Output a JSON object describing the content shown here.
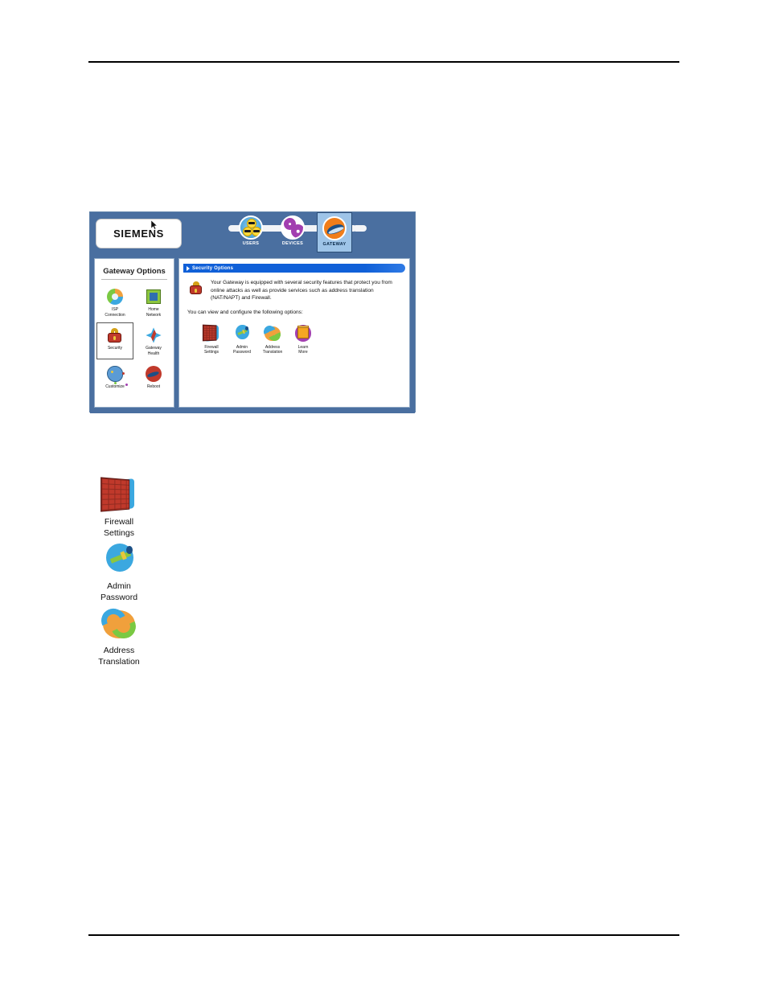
{
  "document": {
    "has_top_rule": true,
    "has_bottom_rule": true
  },
  "ui": {
    "brand": "SIEMENS",
    "cursor_icon": "mouse-pointer-icon",
    "nav_tabs": [
      {
        "label": "USERS",
        "icon": "users-faces-icon",
        "selected": false
      },
      {
        "label": "DEVICES",
        "icon": "gears-icon",
        "selected": false
      },
      {
        "label": "GATEWAY",
        "icon": "gateway-swoosh-icon",
        "selected": true
      }
    ],
    "sidebar": {
      "title": "Gateway Options",
      "items": [
        {
          "label": "ISP\nConnection",
          "line1": "ISP",
          "line2": "Connection",
          "icon": "isp-connection-icon",
          "selected": false
        },
        {
          "label": "Home Network",
          "line1": "Home",
          "line2": "Network",
          "icon": "home-network-icon",
          "selected": false
        },
        {
          "label": "Security",
          "line1": "Security",
          "line2": "",
          "icon": "security-padlock-icon",
          "selected": true
        },
        {
          "label": "Gateway Health",
          "line1": "Gateway",
          "line2": "Health",
          "icon": "gateway-health-icon",
          "selected": false
        },
        {
          "label": "Customize",
          "line1": "Customize",
          "line2": "",
          "icon": "customize-palette-icon",
          "selected": false
        },
        {
          "label": "Reboot",
          "line1": "Reboot",
          "line2": "",
          "icon": "reboot-icon",
          "selected": false
        }
      ]
    },
    "content": {
      "section_title": "Security Options",
      "section_title_icon": "arrow-bullet-icon",
      "intro_icon": "padlock-icon",
      "intro_paragraph": "Your Gateway is equipped with several security features that protect you from online attacks as well as provide services such as address translation (NAT/NAPT) and Firewall.",
      "subtext": "You can view and configure the following options:",
      "options": [
        {
          "line1": "Firewall",
          "line2": "Settings",
          "icon": "firewall-brick-icon"
        },
        {
          "line1": "Admin",
          "line2": "Password",
          "icon": "admin-password-key-icon"
        },
        {
          "line1": "Address",
          "line2": "Translation",
          "icon": "address-translation-arrows-icon"
        },
        {
          "line1": "Learn",
          "line2": "More",
          "icon": "learn-more-cube-icon"
        }
      ]
    }
  },
  "callouts": [
    {
      "line1": "Firewall",
      "line2": "Settings",
      "icon": "firewall-brick-icon"
    },
    {
      "line1": "Admin",
      "line2": "Password",
      "icon": "admin-password-key-icon"
    },
    {
      "line1": "Address",
      "line2": "Translation",
      "icon": "address-translation-arrows-icon"
    }
  ],
  "colors": {
    "header_blue": "#4a6fa0",
    "title_blue": "#1060d8",
    "selected_tab_blue": "#9ec4e8",
    "panel_border": "#8fa8c4",
    "brick_red": "#c0392b",
    "key_green": "#8cc63f",
    "nat_orange": "#f0a03c",
    "learn_purple": "#a23fb0"
  }
}
